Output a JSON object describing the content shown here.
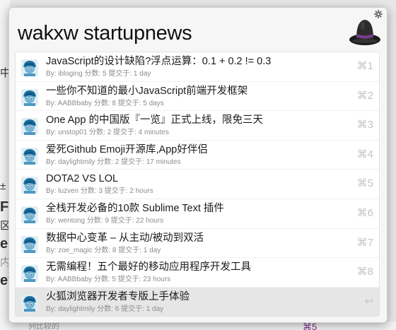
{
  "background": {
    "left_chars": [
      "中",
      "±",
      "Fa",
      "区",
      "e",
      "内",
      "ey"
    ],
    "bottom_text": "列比较的",
    "bottom_hint": "⌘5"
  },
  "launcher": {
    "query": "wakxw startupnews",
    "settings_icon": "gear-icon",
    "logo_icon": "alfred-hat-icon"
  },
  "results": [
    {
      "title": "JavaScript的设计缺陷?浮点运算：0.1 + 0.2 != 0.3",
      "subtitle": "By: ibloging 分数: 5 提交于: 1 day",
      "shortcut": "⌘1"
    },
    {
      "title": "一些你不知道的最小JavaScript前端开发框架",
      "subtitle": "By: AABBbaby 分数: 8 提交于: 5 days",
      "shortcut": "⌘2"
    },
    {
      "title": "One App 的中国版『一览』正式上线，限免三天",
      "subtitle": "By: unstop01 分数: 2 提交于: 4 minutes",
      "shortcut": "⌘3"
    },
    {
      "title": "爱死Github Emoji开源库,App好伴侣",
      "subtitle": "By: daylightmily 分数: 2 提交于: 17 minutes",
      "shortcut": "⌘4"
    },
    {
      "title": "DOTA2 VS LOL",
      "subtitle": "By: luzven 分数: 3 提交于: 2 hours",
      "shortcut": "⌘5"
    },
    {
      "title": "全栈开发必备的10款 Sublime Text 插件",
      "subtitle": "By: wentong 分数: 9 提交于: 22 hours",
      "shortcut": "⌘6"
    },
    {
      "title": "数据中心变革 – 从主动/被动到双活",
      "subtitle": "By: zoe_magic 分数: 8 提交于: 1 day",
      "shortcut": "⌘7"
    },
    {
      "title": "无需编程！五个最好的移动应用程序开发工具",
      "subtitle": "By: AABBbaby 分数: 5 提交于: 23 hours",
      "shortcut": "⌘8"
    },
    {
      "title": "火狐浏览器开发者专版上手体验",
      "subtitle": "By: daylightmily 分数: 6 提交于: 1 day",
      "shortcut": "↩",
      "selected": true
    }
  ]
}
